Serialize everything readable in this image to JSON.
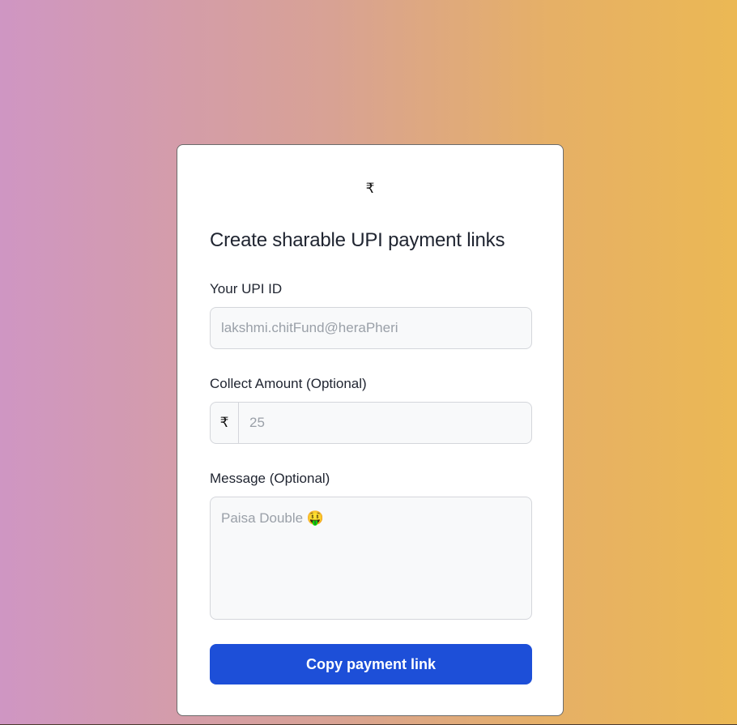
{
  "logo": {
    "symbol": "₹"
  },
  "form": {
    "title": "Create sharable UPI payment links",
    "upi": {
      "label": "Your UPI ID",
      "placeholder": "lakshmi.chitFund@heraPheri",
      "value": ""
    },
    "amount": {
      "label": "Collect Amount (Optional)",
      "currency_symbol": "₹",
      "placeholder": "25",
      "value": ""
    },
    "message": {
      "label": "Message (Optional)",
      "placeholder": "Paisa Double 🤑",
      "value": ""
    },
    "submit_label": "Copy payment link"
  },
  "colors": {
    "accent": "#1d4fd8",
    "background_gradient_start": "#cf96c3",
    "background_gradient_end": "#ebb854"
  }
}
